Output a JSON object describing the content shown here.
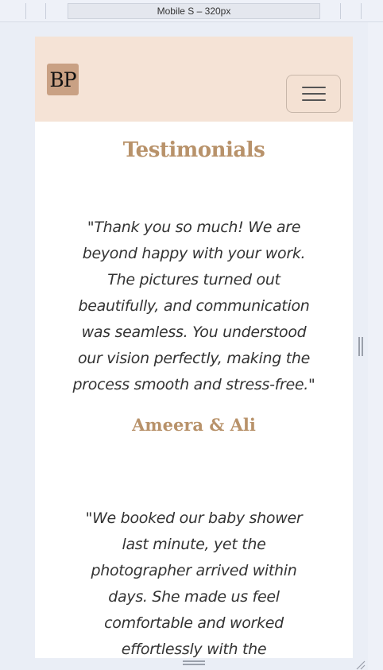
{
  "devtools": {
    "device_label": "Mobile S – 320px"
  },
  "navbar": {
    "logo_text": "BP",
    "toggler_icon": "hamburger-icon",
    "background": "#f5e3d6",
    "logo_background": "#c9a184"
  },
  "testimonials": {
    "heading": "Testimonials",
    "accent_color": "#b8926a",
    "items": [
      {
        "quote_lines": [
          "\"Thank you so much! We are",
          "beyond happy with your work.",
          "The pictures turned out",
          "beautifully, and communication",
          "was seamless. You understood",
          "our vision perfectly, making the",
          "process smooth and stress-free.\""
        ],
        "author": "Ameera & Ali"
      },
      {
        "quote_lines": [
          "\"We booked our baby shower",
          "last minute, yet the",
          "photographer arrived within",
          "days. She made us feel",
          "comfortable and worked",
          "effortlessly with the"
        ]
      }
    ]
  }
}
